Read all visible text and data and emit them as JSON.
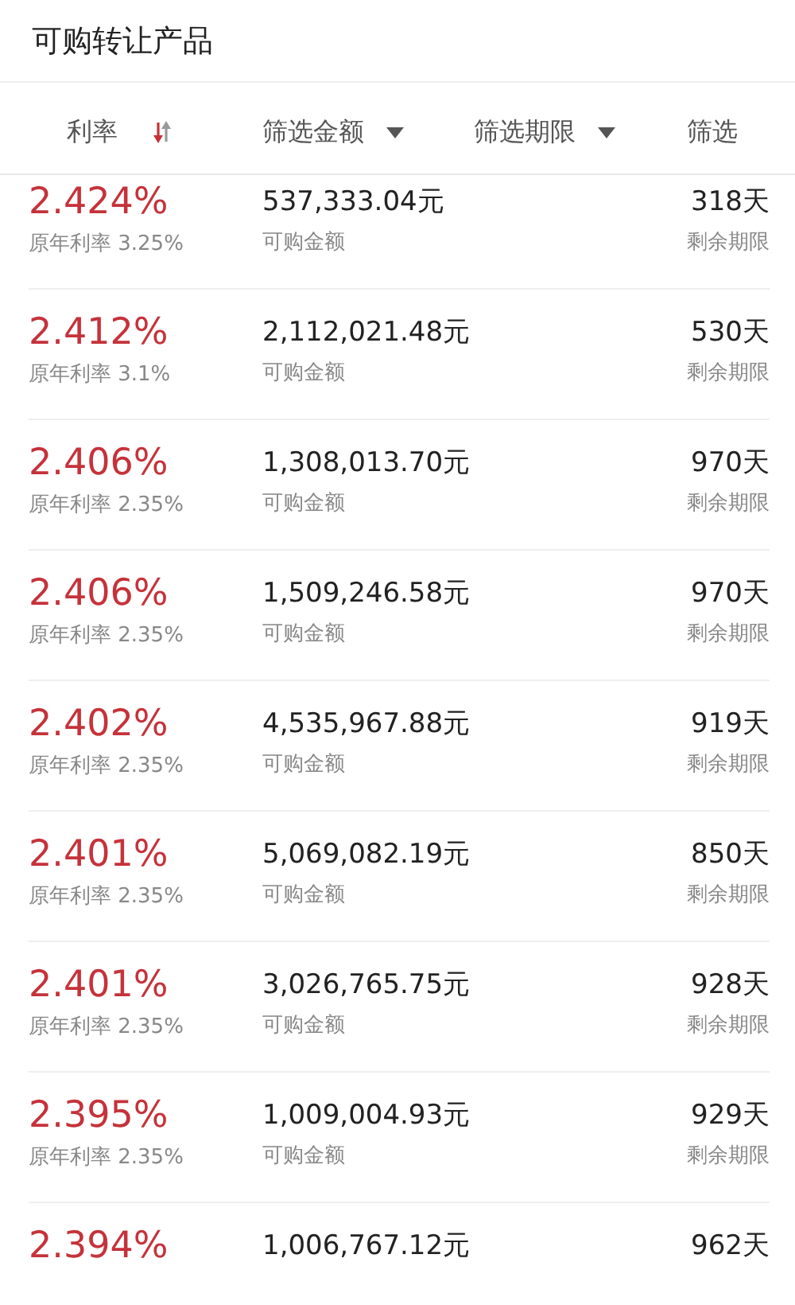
{
  "header": {
    "title": "可购转让产品"
  },
  "filters": [
    {
      "label": "利率",
      "kind": "sort",
      "descending": true
    },
    {
      "label": "筛选金额",
      "kind": "dropdown"
    },
    {
      "label": "筛选期限",
      "kind": "dropdown"
    },
    {
      "label": "筛选",
      "kind": "plain"
    }
  ],
  "products": [
    {
      "rate": "2.424%",
      "original_rate": "原年利率 3.25%",
      "amount": "537,333.04元",
      "amount_label": "可购金额",
      "term": "318天",
      "term_label": "剩余期限"
    },
    {
      "rate": "2.412%",
      "original_rate": "原年利率 3.1%",
      "amount": "2,112,021.48元",
      "amount_label": "可购金额",
      "term": "530天",
      "term_label": "剩余期限"
    },
    {
      "rate": "2.406%",
      "original_rate": "原年利率 2.35%",
      "amount": "1,308,013.70元",
      "amount_label": "可购金额",
      "term": "970天",
      "term_label": "剩余期限"
    },
    {
      "rate": "2.406%",
      "original_rate": "原年利率 2.35%",
      "amount": "1,509,246.58元",
      "amount_label": "可购金额",
      "term": "970天",
      "term_label": "剩余期限"
    },
    {
      "rate": "2.402%",
      "original_rate": "原年利率 2.35%",
      "amount": "4,535,967.88元",
      "amount_label": "可购金额",
      "term": "919天",
      "term_label": "剩余期限"
    },
    {
      "rate": "2.401%",
      "original_rate": "原年利率 2.35%",
      "amount": "5,069,082.19元",
      "amount_label": "可购金额",
      "term": "850天",
      "term_label": "剩余期限"
    },
    {
      "rate": "2.401%",
      "original_rate": "原年利率 2.35%",
      "amount": "3,026,765.75元",
      "amount_label": "可购金额",
      "term": "928天",
      "term_label": "剩余期限"
    },
    {
      "rate": "2.395%",
      "original_rate": "原年利率 2.35%",
      "amount": "1,009,004.93元",
      "amount_label": "可购金额",
      "term": "929天",
      "term_label": "剩余期限"
    },
    {
      "rate": "2.394%",
      "amount": "1,006,767.12元",
      "term": "962天"
    }
  ]
}
